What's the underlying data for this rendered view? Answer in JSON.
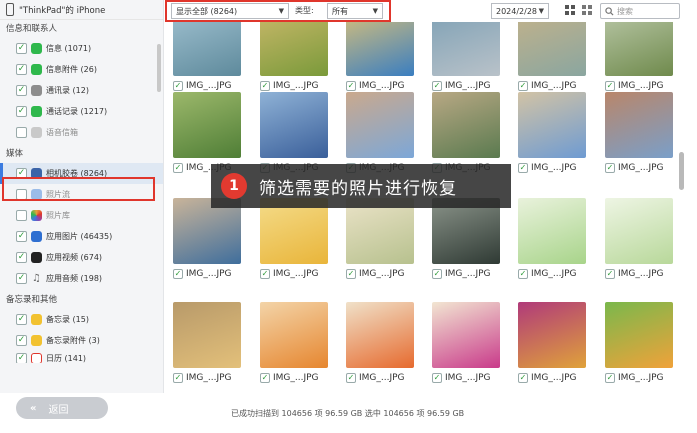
{
  "device": {
    "name": "\"ThinkPad\"的 iPhone"
  },
  "sidebar": {
    "groups": [
      {
        "label": "信息和联系人"
      },
      {
        "label": "媒体"
      },
      {
        "label": "备忘录和其他"
      }
    ],
    "items": [
      {
        "label": "信息 (1071)",
        "checked": true,
        "color": "#2fb84c"
      },
      {
        "label": "信息附件 (26)",
        "checked": true,
        "color": "#2fb84c"
      },
      {
        "label": "通讯录 (12)",
        "checked": true,
        "color": "#8d8d8d"
      },
      {
        "label": "通话记录 (1217)",
        "checked": true,
        "color": "#2fb84c"
      },
      {
        "label": "语音信箱",
        "checked": false,
        "color": "#9a9a9a"
      },
      {
        "label": "相机胶卷 (8264)",
        "checked": true,
        "color": "#3b64a8"
      },
      {
        "label": "照片流",
        "checked": false,
        "color": "#4b8de0"
      },
      {
        "label": "照片库",
        "checked": false,
        "color": "#e9a23b"
      },
      {
        "label": "应用图片 (46435)",
        "checked": true,
        "color": "#2f6fd1"
      },
      {
        "label": "应用视频 (674)",
        "checked": true,
        "color": "#222222"
      },
      {
        "label": "应用音频 (198)",
        "checked": true,
        "color": "#9a9a9a"
      },
      {
        "label": "备忘录 (15)",
        "checked": true,
        "color": "#f2c230"
      },
      {
        "label": "备忘录附件 (3)",
        "checked": true,
        "color": "#f2c230"
      },
      {
        "label": "日历 (141)",
        "checked": true,
        "color": "#e0362c"
      }
    ],
    "back_label": "返回"
  },
  "toolbar": {
    "filter_value": "显示全部 (8264)",
    "type_label": "类型:",
    "type_value": "所有",
    "date_value": "2024/2/28",
    "search_placeholder": "搜索"
  },
  "overlay": {
    "badge": "1",
    "text": "筛选需要的照片进行恢复"
  },
  "photos": [
    {
      "caption": "IMG_...JPG",
      "colors": [
        "#5e8a9c",
        "#9fc0cf"
      ]
    },
    {
      "caption": "IMG_...JPG",
      "colors": [
        "#7a9a3a",
        "#c9b86a"
      ]
    },
    {
      "caption": "IMG_...JPG",
      "colors": [
        "#3a7ec0",
        "#d8c07a"
      ]
    },
    {
      "caption": "IMG_...JPG",
      "colors": [
        "#b9c2c9",
        "#7fa1b5"
      ]
    },
    {
      "caption": "IMG_...JPG",
      "colors": [
        "#8aa6a0",
        "#c3b28a"
      ]
    },
    {
      "caption": "IMG_...JPG",
      "colors": [
        "#6f8a4c",
        "#b9c7a7"
      ]
    },
    {
      "caption": "IMG_...JPG",
      "colors": [
        "#4f7e36",
        "#9cb86b"
      ]
    },
    {
      "caption": "IMG_...JPG",
      "colors": [
        "#3a5f9a",
        "#8fb2d6"
      ]
    },
    {
      "caption": "IMG_...JPG",
      "colors": [
        "#7ca7d8",
        "#caa98d"
      ]
    },
    {
      "caption": "IMG_...JPG",
      "colors": [
        "#5a7a4f",
        "#b8a884"
      ]
    },
    {
      "caption": "IMG_...JPG",
      "colors": [
        "#6e9bd2",
        "#d2c3a5"
      ]
    },
    {
      "caption": "IMG_...JPG",
      "colors": [
        "#7a9fc9",
        "#b9866a"
      ]
    },
    {
      "caption": "IMG_...JPG",
      "colors": [
        "#3f6e9c",
        "#c9b49a"
      ]
    },
    {
      "caption": "IMG_...JPG",
      "colors": [
        "#e9b53a",
        "#f4dc8a"
      ]
    },
    {
      "caption": "IMG_...JPG",
      "colors": [
        "#b7c18e",
        "#ebe3c8"
      ]
    },
    {
      "caption": "IMG_...JPG",
      "colors": [
        "#2f3a34",
        "#8b948a"
      ]
    },
    {
      "caption": "IMG_...JPG",
      "colors": [
        "#a8d48a",
        "#e9f2dc"
      ]
    },
    {
      "caption": "IMG_...JPG",
      "colors": [
        "#b8d89a",
        "#eef5e4"
      ]
    },
    {
      "caption": "IMG_...JPG",
      "colors": [
        "#e3c07a",
        "#b89a6a"
      ]
    },
    {
      "caption": "IMG_...JPG",
      "colors": [
        "#e6862f",
        "#f3d4a8"
      ]
    },
    {
      "caption": "IMG_...JPG",
      "colors": [
        "#e66a2e",
        "#f0e1c9"
      ]
    },
    {
      "caption": "IMG_...JPG",
      "colors": [
        "#c93a8a",
        "#f2e6d2"
      ]
    },
    {
      "caption": "IMG_...JPG",
      "colors": [
        "#e0a23a",
        "#b03a7a"
      ]
    },
    {
      "caption": "IMG_...JPG",
      "colors": [
        "#f0a23a",
        "#7ab84c"
      ]
    }
  ],
  "footer": {
    "status": "已成功扫描到 104656 项 96.59 GB  选中 104656 项 96.59 GB"
  }
}
